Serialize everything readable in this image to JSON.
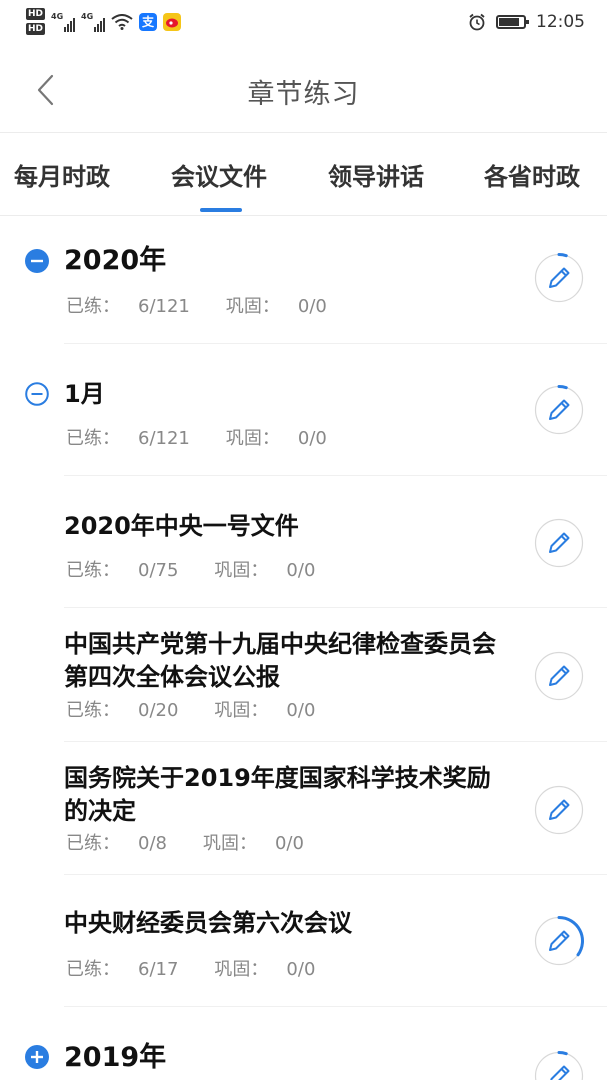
{
  "status_bar": {
    "time": "12:05",
    "hd1": "HD",
    "hd2": "HD",
    "sig1": "4G",
    "sig2": "4G",
    "alipay": "支"
  },
  "header": {
    "title": "章节练习"
  },
  "tabs": [
    {
      "label": "每月时政",
      "active": false
    },
    {
      "label": "会议文件",
      "active": true
    },
    {
      "label": "领导讲话",
      "active": false
    },
    {
      "label": "各省时政",
      "active": false
    }
  ],
  "practiced_label": "已练：",
  "consolidated_label": "巩固：",
  "items": [
    {
      "title": "2020年",
      "practiced": "6/121",
      "consolidated": "0/0",
      "level": "year",
      "toggle": "collapse-filled",
      "progress": 0.05
    },
    {
      "title": "1月",
      "practiced": "6/121",
      "consolidated": "0/0",
      "level": "month",
      "toggle": "collapse-outline",
      "progress": 0.05
    },
    {
      "title": "2020年中央一号文件",
      "practiced": "0/75",
      "consolidated": "0/0",
      "level": "chapter",
      "progress": 0
    },
    {
      "title": "中国共产党第十九届中央纪律检查委员会第四次全体会议公报",
      "practiced": "0/20",
      "consolidated": "0/0",
      "level": "chapter",
      "progress": 0
    },
    {
      "title": "国务院关于2019年度国家科学技术奖励的决定",
      "practiced": "0/8",
      "consolidated": "0/0",
      "level": "chapter",
      "progress": 0
    },
    {
      "title": "中央财经委员会第六次会议",
      "practiced": "6/17",
      "consolidated": "0/0",
      "level": "chapter",
      "progress": 0.35
    },
    {
      "title": "2019年",
      "practiced": "",
      "consolidated": "",
      "level": "year",
      "toggle": "expand-filled",
      "progress": 0.05
    }
  ],
  "colors": {
    "accent": "#2a7de1",
    "text": "#111111",
    "muted": "#888888",
    "divider": "#f0f0f0"
  }
}
